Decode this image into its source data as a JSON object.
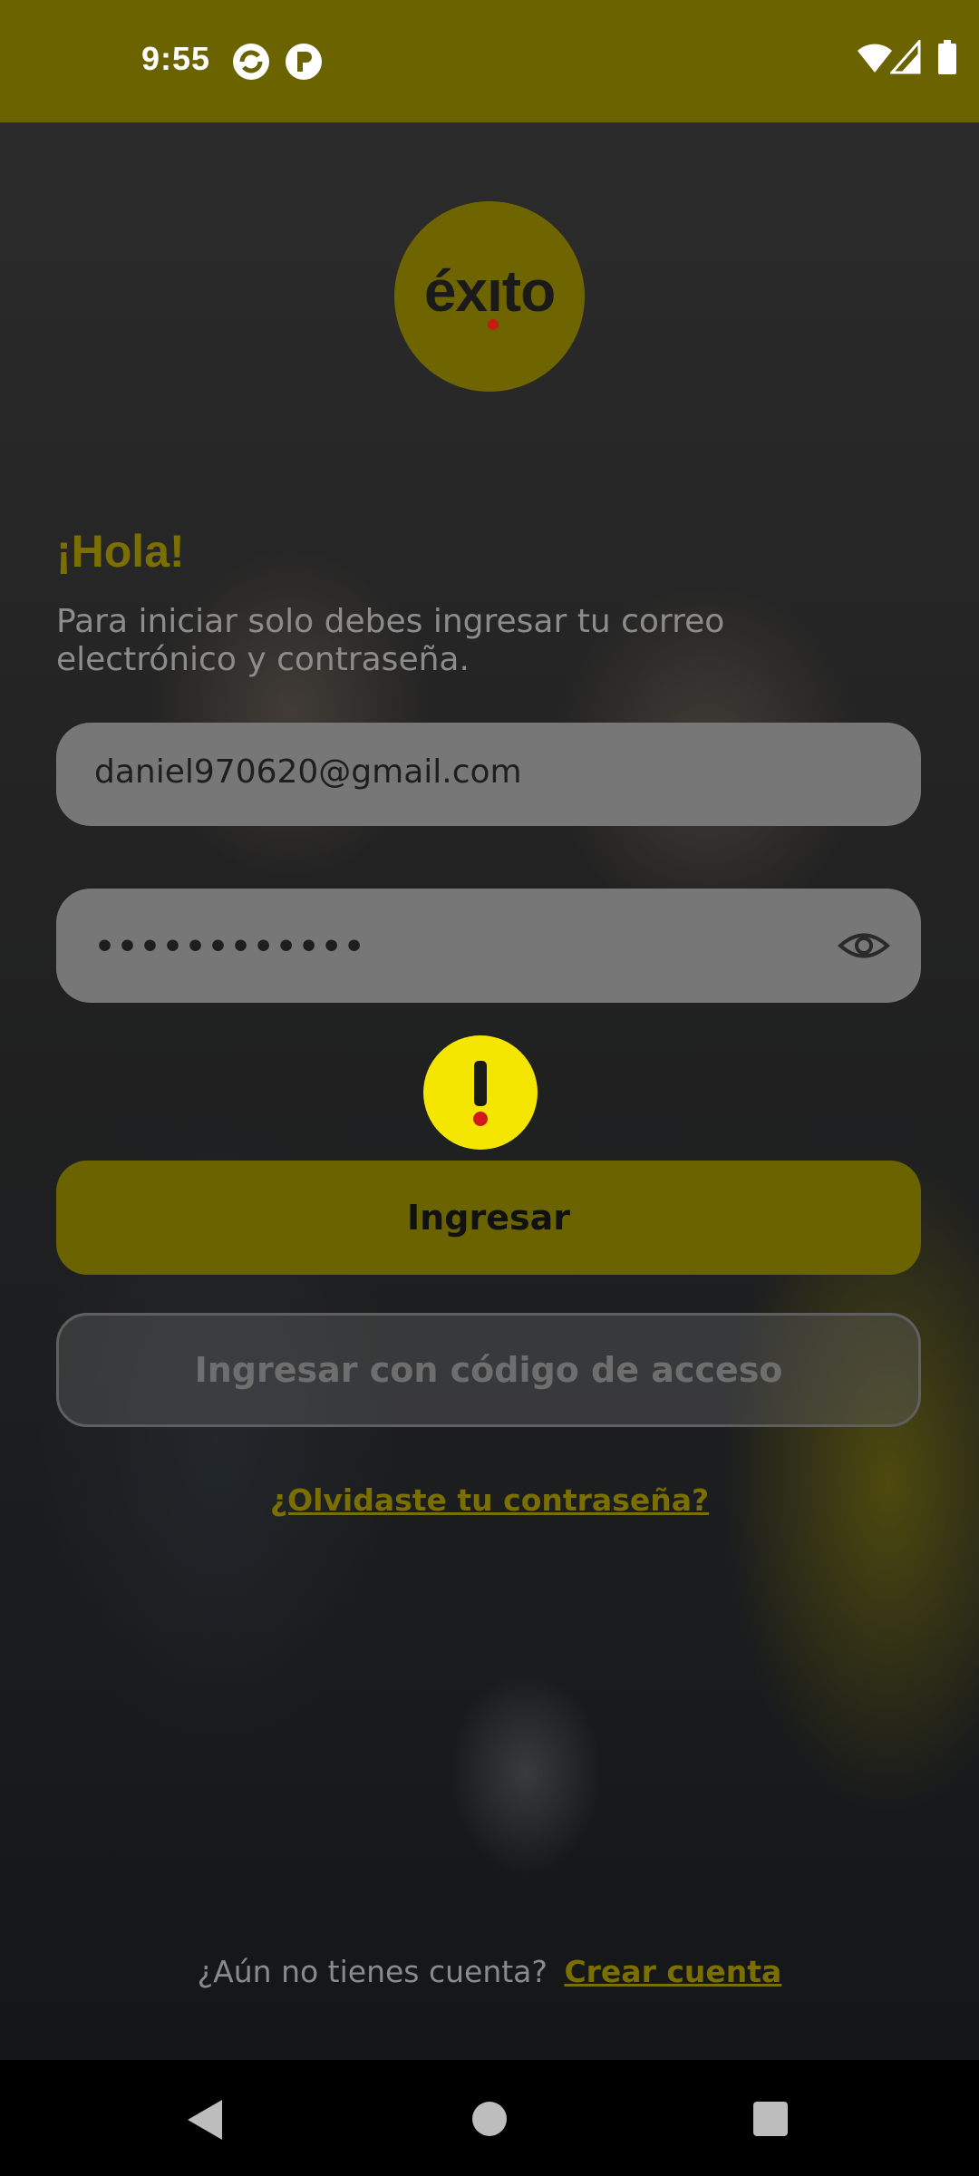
{
  "status_bar": {
    "time": "9:55",
    "left_icons": [
      "sync-app-icon",
      "pocket-app-icon"
    ],
    "right_icons": [
      "wifi-icon",
      "cell-signal-icon",
      "battery-icon"
    ]
  },
  "logo": {
    "text": "éxıto",
    "icon": "exito-logo"
  },
  "greeting": "¡Hola!",
  "subtitle": "Para iniciar solo debes ingresar tu correo electrónico y contraseña.",
  "email": {
    "value": "daniel970620@gmail.com"
  },
  "password": {
    "value": "••••••••••••",
    "toggle_icon": "eye-icon"
  },
  "warning": {
    "icon": "exclamation-icon",
    "symbol": "!"
  },
  "buttons": {
    "login": "Ingresar",
    "access_code": "Ingresar con código de acceso"
  },
  "forgot_password": "¿Olvidaste tu contraseña?",
  "signup": {
    "question": "¿Aún no tienes cuenta?",
    "link": "Crear cuenta"
  },
  "nav": {
    "icons": [
      "back-icon",
      "home-icon",
      "recents-icon"
    ]
  },
  "colors": {
    "status_bar": "#6b6200",
    "accent_text": "#7a6f00",
    "warning": "#f4e600",
    "warning_mark": "#d11a1a"
  }
}
